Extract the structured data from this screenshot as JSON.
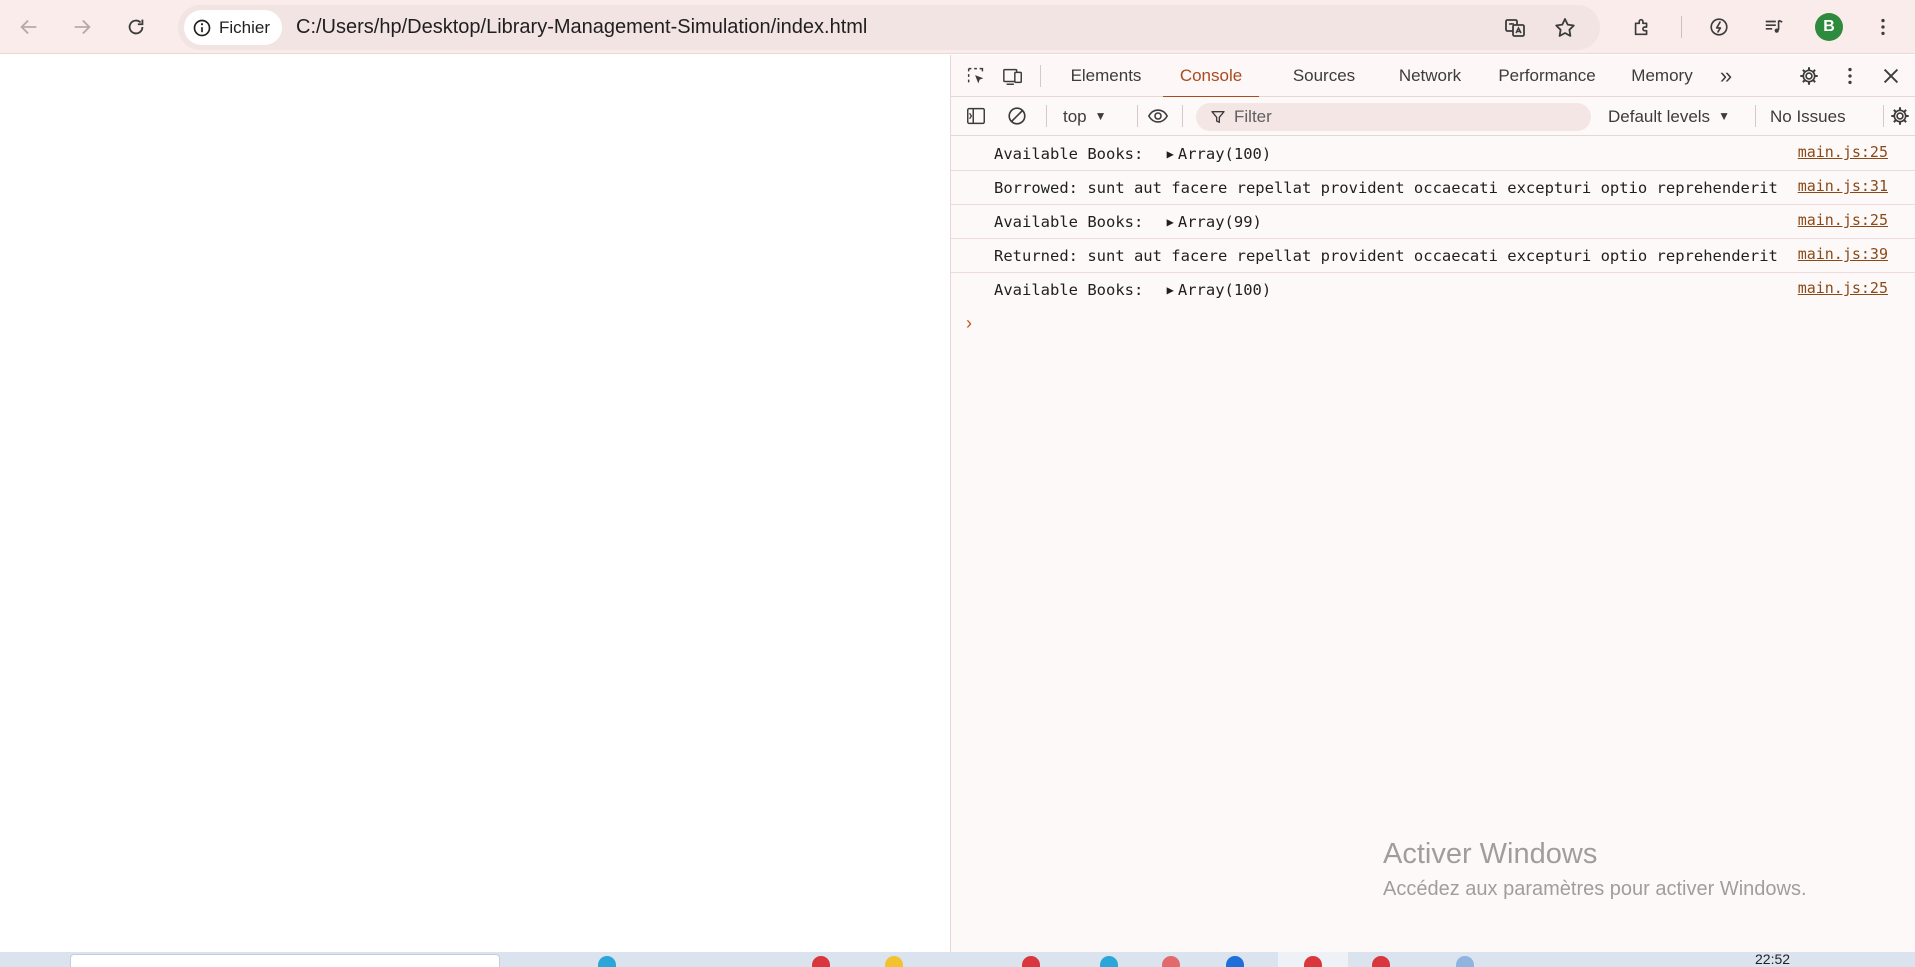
{
  "browser": {
    "security_chip_label": "Fichier",
    "url": "C:/Users/hp/Desktop/Library-Management-Simulation/index.html",
    "profile_initial": "B",
    "accent_color": "#2e8b3e"
  },
  "devtools": {
    "tabs": [
      {
        "label": "Elements",
        "active": false
      },
      {
        "label": "Console",
        "active": true
      },
      {
        "label": "Sources",
        "active": false
      },
      {
        "label": "Network",
        "active": false
      },
      {
        "label": "Performance",
        "active": false
      },
      {
        "label": "Memory",
        "active": false
      }
    ],
    "more_tabs_glyph": "»",
    "context": "top",
    "filter_placeholder": "Filter",
    "levels": "Default levels",
    "issues": "No Issues",
    "accent_color": "#a84c1f",
    "messages": [
      {
        "text": "Available Books: ",
        "array": "Array(100)",
        "source": "main.js:25"
      },
      {
        "text": "Borrowed: sunt aut facere repellat provident occaecati excepturi optio reprehenderit",
        "array": "",
        "source": "main.js:31"
      },
      {
        "text": "Available Books: ",
        "array": "Array(99)",
        "source": "main.js:25"
      },
      {
        "text": "Returned: sunt aut facere repellat provident occaecati excepturi optio reprehenderit",
        "array": "",
        "source": "main.js:39"
      },
      {
        "text": "Available Books: ",
        "array": "Array(100)",
        "source": "main.js:25"
      }
    ],
    "prompt_glyph": "›"
  },
  "watermark": {
    "title": "Activer Windows",
    "subtitle": "Accédez aux paramètres pour activer Windows."
  },
  "taskbar": {
    "clock": "22:52"
  }
}
